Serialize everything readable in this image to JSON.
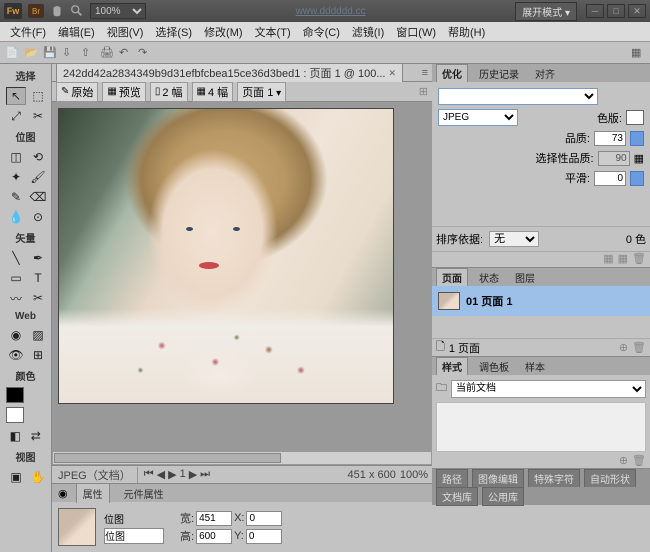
{
  "titlebar": {
    "logo": "Fw",
    "br": "Br",
    "zoom": "100%",
    "url": "www.dddddd.cc",
    "mode": "展开模式 ▾"
  },
  "menu": [
    "文件(F)",
    "编辑(E)",
    "视图(V)",
    "选择(S)",
    "修改(M)",
    "文本(T)",
    "命令(C)",
    "滤镜(I)",
    "窗口(W)",
    "帮助(H)"
  ],
  "doc": {
    "title": "242dd42a2834349b9d31efbfcbea15ce36d3bed1 : 页面 1 @ 100..."
  },
  "viewbar": {
    "orig": "原始",
    "preview": "预览",
    "two": "2 幅",
    "four": "4 幅",
    "page": "页面 1"
  },
  "status": {
    "format": "JPEG（文档）",
    "frame": "1",
    "dims": "451 x 600",
    "zoom": "100%"
  },
  "props": {
    "tab1": "属性",
    "tab2": "元件属性",
    "type1": "位图",
    "type2": "位图",
    "w": "451",
    "h": "600",
    "x": "0",
    "y": "0",
    "wlbl": "宽:",
    "hlbl": "高:",
    "xlbl": "X:",
    "ylbl": "Y:"
  },
  "side": {
    "sel": "选择",
    "bmp": "位图",
    "vec": "矢量",
    "web": "Web",
    "color": "颜色",
    "view": "视图"
  },
  "optimize": {
    "t1": "优化",
    "t2": "历史记录",
    "t3": "对齐",
    "format": "JPEG",
    "pal": "色版:",
    "quality": "品质:",
    "qval": "73",
    "selq": "选择性品质:",
    "selqval": "90",
    "smooth": "平滑:",
    "sval": "0",
    "sort": "排序依据:",
    "sortv": "无",
    "colors": "0 色"
  },
  "pages": {
    "t1": "页面",
    "t2": "状态",
    "t3": "图层",
    "name": "01 页面 1",
    "foot": "1 页面"
  },
  "styles": {
    "t1": "样式",
    "t2": "调色板",
    "t3": "样本",
    "cur": "当前文档"
  },
  "bottom": {
    "w1": "文档库",
    "w2": "公用库",
    "r1": "路径",
    "r2": "图像编辑",
    "r3": "特殊字符",
    "r4": "自动形状"
  }
}
